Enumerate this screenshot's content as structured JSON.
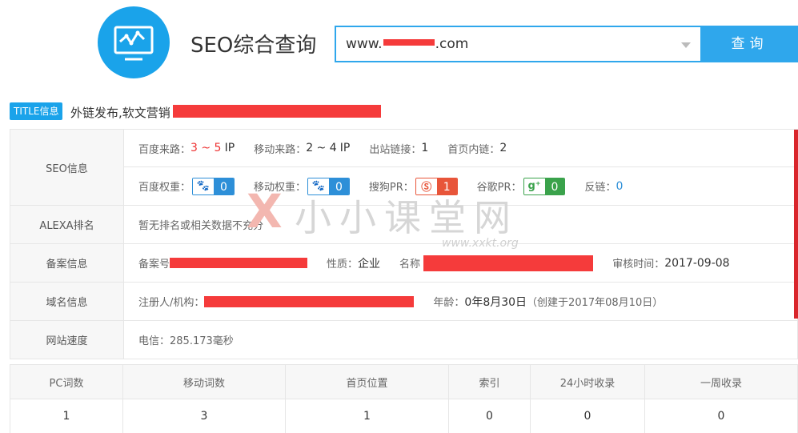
{
  "header": {
    "app_title": "SEO综合查询",
    "search_prefix": "www.",
    "search_suffix": ".com",
    "search_button": "查询"
  },
  "title_info": {
    "badge": "TITLE信息",
    "text": "外链发布,软文营销"
  },
  "seo": {
    "label": "SEO信息",
    "baidu_source_label": "百度来路：",
    "baidu_source_value": "3 ~ 5",
    "baidu_source_unit": "IP",
    "mobile_source_label": "移动来路：",
    "mobile_source_value": "2 ~ 4",
    "mobile_source_unit": "IP",
    "outbound_label": "出站链接：",
    "outbound_value": "1",
    "home_links_label": "首页内链：",
    "home_links_value": "2",
    "baidu_weight_label": "百度权重：",
    "baidu_weight_value": "0",
    "mobile_weight_label": "移动权重：",
    "mobile_weight_value": "0",
    "sogou_pr_label": "搜狗PR：",
    "sogou_pr_value": "1",
    "google_pr_label": "谷歌PR：",
    "google_pr_value": "0",
    "backlinks_label": "反链：",
    "backlinks_value": "0"
  },
  "alexa": {
    "label": "ALEXA排名",
    "value": "暂无排名或相关数据不充分"
  },
  "icp": {
    "label": "备案信息",
    "number_label": "备案号",
    "type_label": "性质：",
    "type_value": "企业",
    "name_label": "名称",
    "audit_label": "审核时间：",
    "audit_value": "2017-09-08"
  },
  "domain": {
    "label": "域名信息",
    "registrant_label": "注册人/机构：",
    "age_label": "年龄：",
    "age_value": "0年8月30日",
    "created_text": "（创建于2017年08月10日）"
  },
  "speed": {
    "label": "网站速度",
    "value": "电信：285.173毫秒"
  },
  "watermark": {
    "mark": "X",
    "text": "小小课堂网",
    "url": "www.xxkt.org"
  },
  "stats": {
    "headers": [
      "PC词数",
      "移动词数",
      "首页位置",
      "索引",
      "24小时收录",
      "一周收录"
    ],
    "values": [
      "1",
      "3",
      "1",
      "0",
      "0",
      "0"
    ]
  },
  "colors": {
    "accent": "#1aa3ea",
    "redaction": "#f53b3b",
    "sogou": "#e8553a",
    "google": "#3aa24b",
    "baidu": "#2d8fd8"
  },
  "icons": {
    "logo": "line-chart-monitor-icon",
    "baidu": "paw-icon",
    "sogou": "sogou-s-icon",
    "google": "google-plus-icon"
  }
}
